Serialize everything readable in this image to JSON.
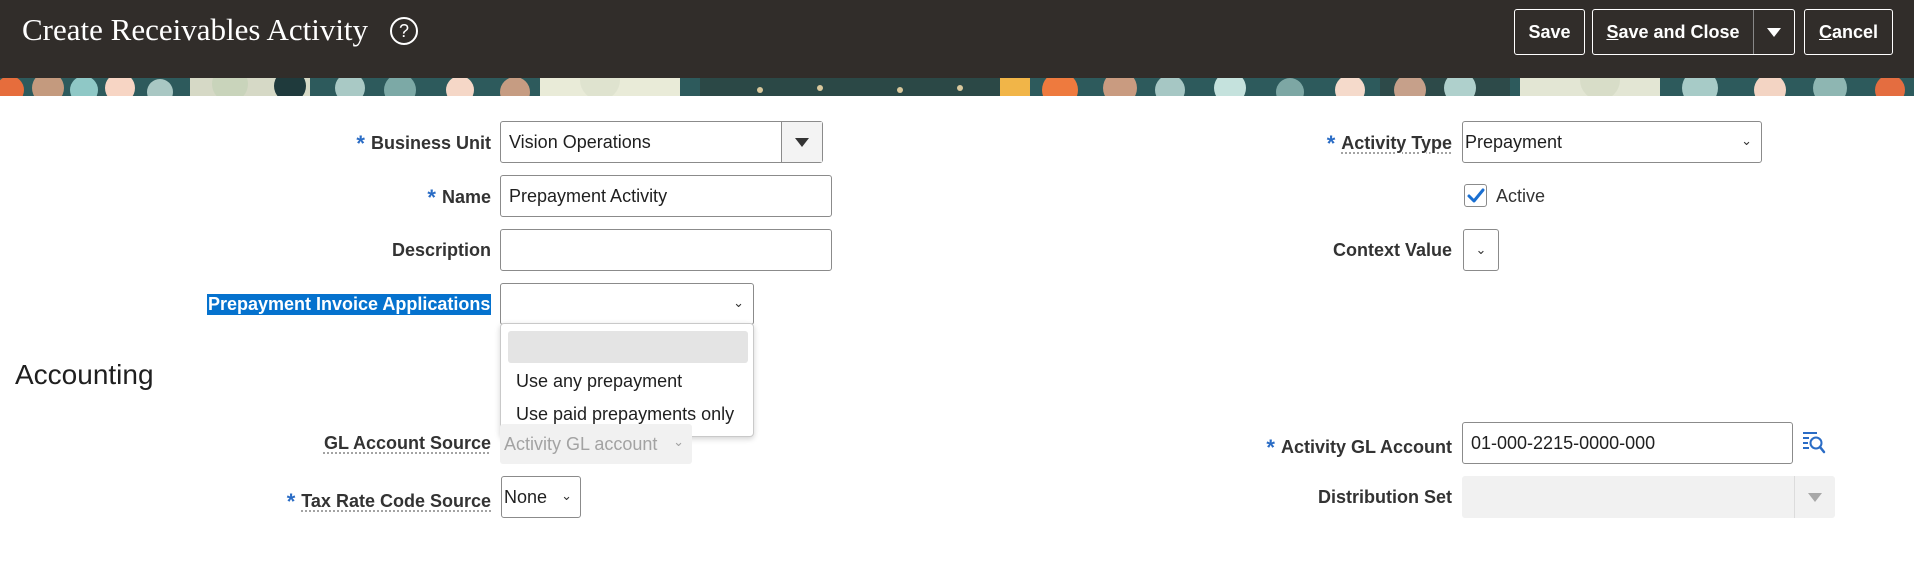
{
  "header": {
    "title": "Create Receivables Activity",
    "help_icon": "help-circle-icon",
    "save_label": "Save",
    "save_close_label": "Save and Close",
    "save_close_accesskey": "S",
    "cancel_label": "Cancel",
    "cancel_accesskey": "C",
    "background": "#312d2a"
  },
  "form": {
    "business_unit": {
      "label": "Business Unit",
      "value": "Vision Operations",
      "required": true
    },
    "name": {
      "label": "Name",
      "value": "Prepayment Activity",
      "required": true
    },
    "description": {
      "label": "Description",
      "value": ""
    },
    "prepayment_invoice_applications": {
      "label": "Prepayment Invoice Applications",
      "value": "",
      "options": [
        "",
        "Use any prepayment",
        "Use paid prepayments only"
      ]
    },
    "activity_type": {
      "label": "Activity Type",
      "value": "Prepayment",
      "required": true
    },
    "active": {
      "label": "Active",
      "checked": true
    },
    "context_value": {
      "label": "Context Value",
      "value": ""
    }
  },
  "accounting": {
    "title": "Accounting",
    "gl_account_source": {
      "label": "GL Account Source",
      "value": "Activity GL account",
      "disabled": true
    },
    "tax_rate_code_source": {
      "label": "Tax Rate Code Source",
      "value": "None",
      "required": true
    },
    "activity_gl_account": {
      "label": "Activity GL Account",
      "value": "01-000-2215-0000-000",
      "required": true
    },
    "distribution_set": {
      "label": "Distribution Set",
      "value": "",
      "disabled": true
    }
  },
  "colors": {
    "accent": "#2a6cc5",
    "selection": "#0572ce",
    "disabled_bg": "#f1f1f1"
  }
}
